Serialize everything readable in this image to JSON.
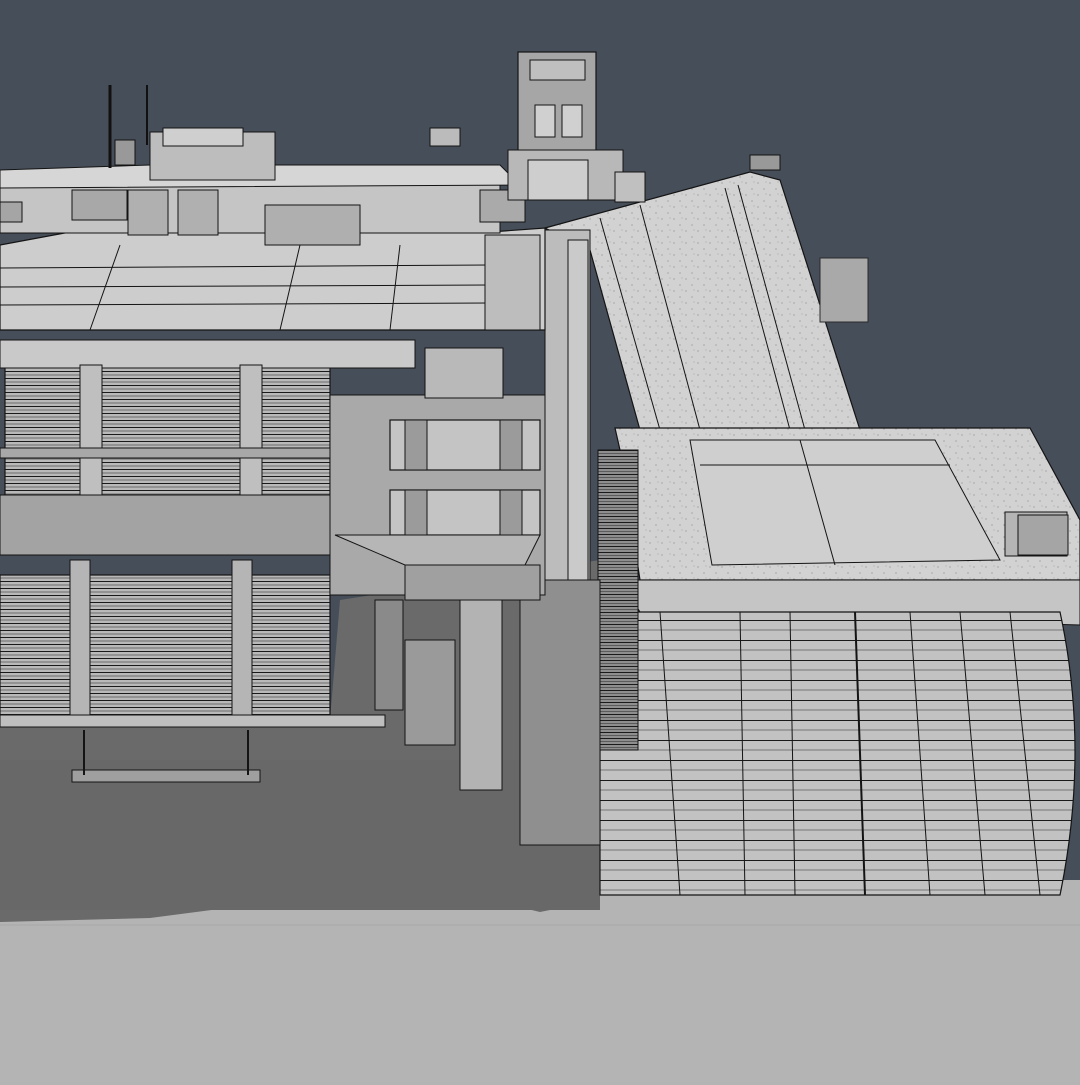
{
  "scene": {
    "kind": "3d-viewport-render",
    "colors": {
      "sky": "#464e59",
      "ground": "#b4b4b4",
      "shadow": "#6a6a6a",
      "surface_light": "#d4d4d4",
      "surface_mid": "#bdbdbd",
      "surface_dark": "#9a9a9a",
      "edge": "#141414"
    }
  }
}
